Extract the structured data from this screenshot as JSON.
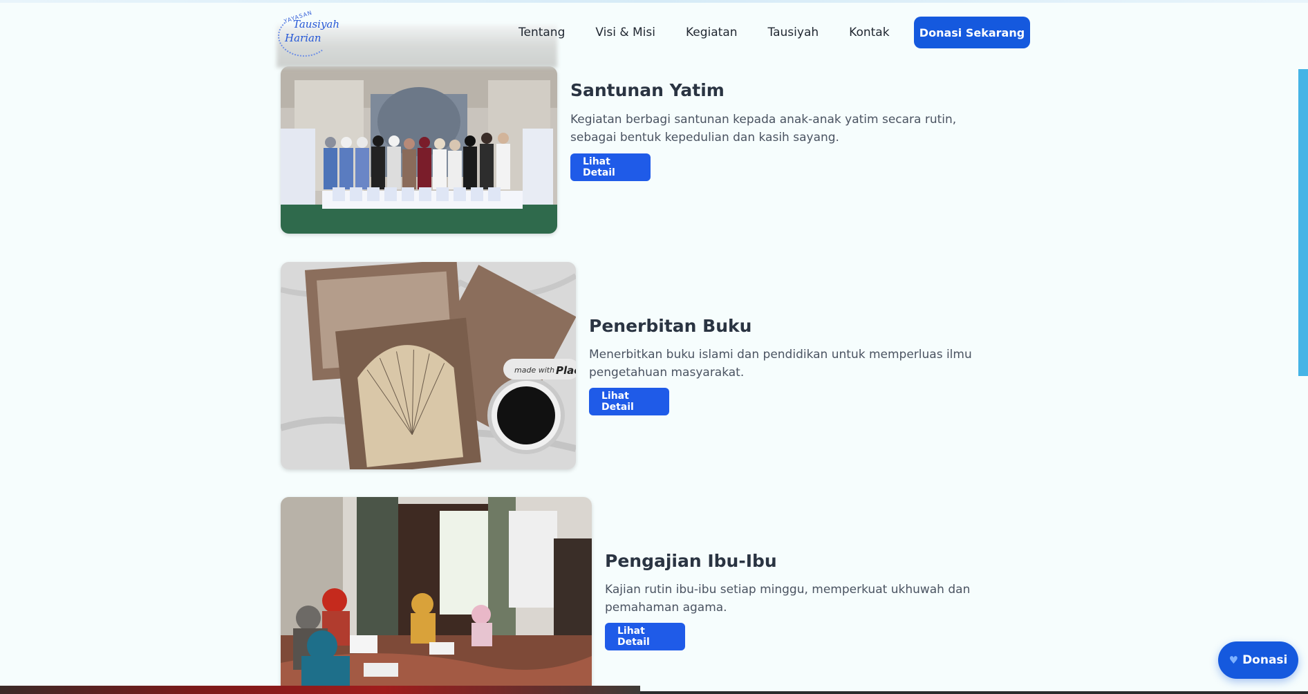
{
  "brand": {
    "logo_top": "YAYASAN",
    "logo_line1": "Tausiyah",
    "logo_line2": "Harian"
  },
  "nav": {
    "items": [
      "Tentang",
      "Visi & Misi",
      "Kegiatan",
      "Tausiyah",
      "Kontak"
    ],
    "cta": "Donasi Sekarang"
  },
  "activities": [
    {
      "title": "Santunan Yatim",
      "description": "Kegiatan berbagi santunan kepada anak-anak yatim secara rutin, sebagai bentuk kepedulian dan kasih sayang.",
      "button": "Lihat Detail"
    },
    {
      "title": "Penerbitan Buku",
      "description": "Menerbitkan buku islami dan pendidikan untuk memperluas ilmu pengetahuan masyarakat.",
      "button": "Lihat Detail",
      "image_watermark": "made with Plac"
    },
    {
      "title": "Pengajian Ibu-Ibu",
      "description": "Kajian rutin ibu-ibu setiap minggu, memperkuat ukhuwah dan pemahaman agama.",
      "button": "Lihat Detail"
    }
  ],
  "floating": {
    "icon": "heart-icon",
    "label": "Donasi"
  },
  "colors": {
    "primary": "#1559de",
    "background": "#f6fdfd",
    "accent_bar": "#45b4e6"
  }
}
